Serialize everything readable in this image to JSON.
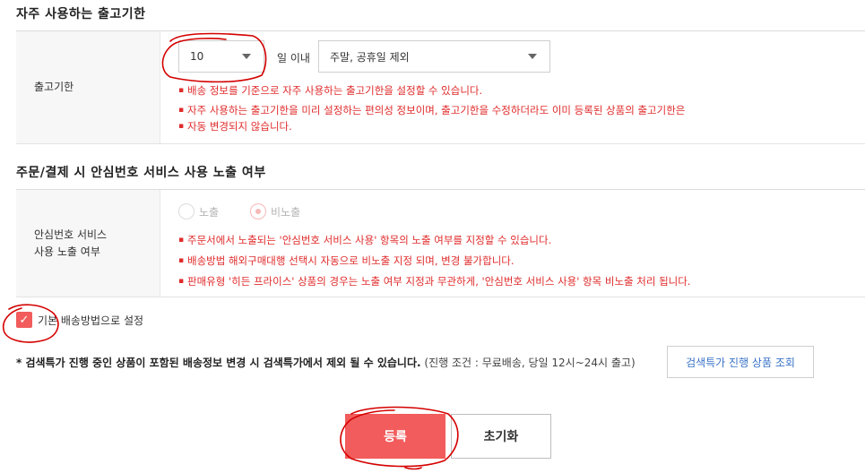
{
  "delivery_section": {
    "title": "자주 사용하는 출고기한",
    "row_label": "출고기한",
    "days_select_value": "10",
    "days_suffix": "일 이내",
    "exclusion_select_value": "주말, 공휴일 제외",
    "notes": [
      "배송 정보를 기준으로 자주 사용하는 출고기한을 설정할 수 있습니다.",
      "자주 사용하는 출고기한을 미리 설정하는 편의성 정보이며, 출고기한을 수정하더라도 이미 등록된 상품의 출고기한은",
      "자동 변경되지 않습니다."
    ]
  },
  "safe_number_section": {
    "title": "주문/결제 시 안심번호 서비스 사용 노출 여부",
    "row_label_line1": "안심번호 서비스",
    "row_label_line2": "사용 노출 여부",
    "radio_show_label": "노출",
    "radio_hide_label": "비노출",
    "selected": "비노출",
    "notes": [
      "주문서에서 노출되는 '안심번호 서비스 사용' 항목의 노출 여부를 지정할 수 있습니다.",
      "배송방법 해외구매대행 선택시 자동으로 비노출 지정 되며, 변경 불가합니다.",
      "판매유형 '히든 프라이스' 상품의 경우는 노출 여부 지정과 무관하게, '안심번호 서비스 사용' 항목 비노출 처리 됩니다."
    ]
  },
  "default_shipping": {
    "label": "기본 배송방법으로 설정",
    "checked": true
  },
  "notice": {
    "strong_text": "* 검색특가 진행 중인 상품이 포함된 배송정보 변경 시 검색특가에서 제외 될 수 있습니다.",
    "weak_text": "(진행 조건 : 무료배송, 당일 12시~24시 출고)",
    "button_label": "검색특가 진행 상품 조회"
  },
  "actions": {
    "register_label": "등록",
    "reset_label": "초기화"
  },
  "colors": {
    "accent": "#f25c5c",
    "warning_text": "#e02b2b",
    "link_text": "#3a73c8",
    "annotation": "#d40000"
  },
  "icons": {
    "select_caret": "caret-down-icon",
    "checkbox": "checkmark-icon"
  }
}
